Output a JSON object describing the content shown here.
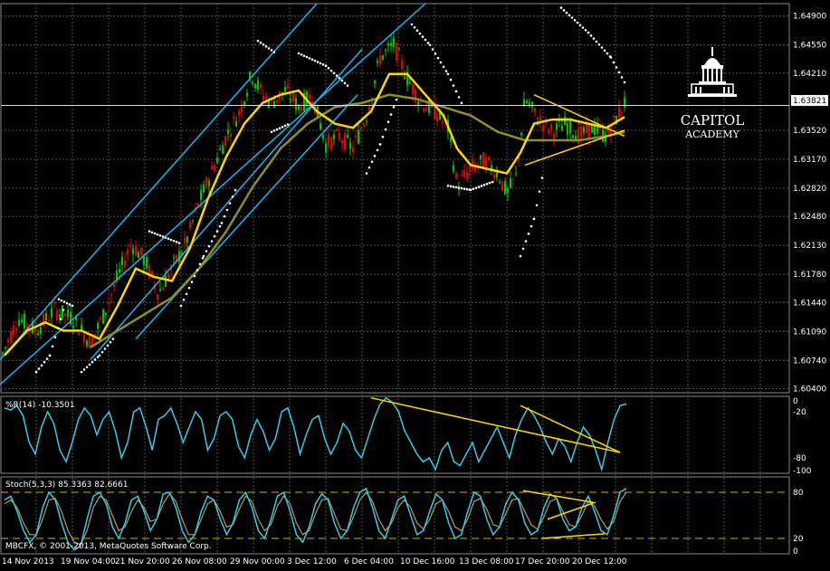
{
  "colors": {
    "background": "#000000",
    "grid": "#4a5a4a",
    "bull": "#00c800",
    "bear": "#e60000",
    "ma_fast": "#ffd700",
    "ma_slow": "#8f8f2a",
    "channel": "#1eb4f0",
    "sar": "#ffffff",
    "wpr": "#3cc8e6",
    "stoch_main": "#3cc8e6",
    "stoch_signal": "#b4a050",
    "trendline": "#ffd700",
    "level": "#c8b400"
  },
  "logo": {
    "line1": "CAPITOL",
    "line2": "ACADEMY",
    "icon": "capitol-dome-icon"
  },
  "current_price": "1.63821",
  "wpr_label": "%R(14) -10.3501",
  "stoch_label": "Stoch(5,3,3) 85.3363 82.6661",
  "copyright": "MBCFX, © 2001-2013, MetaQuotes Software Corp.",
  "chart_data": [
    {
      "type": "candlestick",
      "title": "",
      "ylim": [
        1.6035,
        1.6505
      ],
      "y_ticks": [
        "1.64900",
        "1.64550",
        "1.64210",
        "1.63520",
        "1.63170",
        "1.62820",
        "1.62480",
        "1.62130",
        "1.61780",
        "1.61440",
        "1.61090",
        "1.60740",
        "1.60400"
      ],
      "x_ticks": [
        "14 Nov 2013",
        "19 Nov 04:00",
        "21 Nov 20:00",
        "26 Nov 08:00",
        "29 Nov 00:00",
        "3 Dec 12:00",
        "6 Dec 04:00",
        "10 Dec 16:00",
        "13 Dec 08:00",
        "17 Dec 20:00",
        "20 Dec 12:00"
      ],
      "price_path": [
        [
          0,
          1.6075
        ],
        [
          20,
          1.6125
        ],
        [
          40,
          1.611
        ],
        [
          60,
          1.6135
        ],
        [
          80,
          1.6125
        ],
        [
          100,
          1.6095
        ],
        [
          115,
          1.613
        ],
        [
          130,
          1.6175
        ],
        [
          145,
          1.6215
        ],
        [
          160,
          1.6195
        ],
        [
          175,
          1.6155
        ],
        [
          190,
          1.6185
        ],
        [
          205,
          1.6215
        ],
        [
          220,
          1.6265
        ],
        [
          235,
          1.6305
        ],
        [
          250,
          1.6345
        ],
        [
          265,
          1.6375
        ],
        [
          278,
          1.642
        ],
        [
          290,
          1.6395
        ],
        [
          300,
          1.6385
        ],
        [
          315,
          1.64
        ],
        [
          330,
          1.638
        ],
        [
          345,
          1.6395
        ],
        [
          360,
          1.6335
        ],
        [
          375,
          1.6345
        ],
        [
          390,
          1.633
        ],
        [
          405,
          1.637
        ],
        [
          420,
          1.644
        ],
        [
          435,
          1.6455
        ],
        [
          450,
          1.6415
        ],
        [
          465,
          1.6385
        ],
        [
          480,
          1.6375
        ],
        [
          495,
          1.6355
        ],
        [
          505,
          1.6285
        ],
        [
          520,
          1.6305
        ],
        [
          535,
          1.6315
        ],
        [
          550,
          1.63
        ],
        [
          560,
          1.6275
        ],
        [
          570,
          1.6295
        ],
        [
          580,
          1.639
        ],
        [
          595,
          1.6365
        ],
        [
          610,
          1.635
        ],
        [
          625,
          1.636
        ],
        [
          640,
          1.6345
        ],
        [
          655,
          1.6355
        ],
        [
          670,
          1.6345
        ],
        [
          680,
          1.6365
        ],
        [
          690,
          1.6385
        ]
      ],
      "ma_fast": [
        [
          5,
          1.608
        ],
        [
          30,
          1.611
        ],
        [
          50,
          1.612
        ],
        [
          70,
          1.611
        ],
        [
          90,
          1.611
        ],
        [
          110,
          1.61
        ],
        [
          130,
          1.614
        ],
        [
          150,
          1.6185
        ],
        [
          170,
          1.6175
        ],
        [
          190,
          1.617
        ],
        [
          210,
          1.621
        ],
        [
          230,
          1.627
        ],
        [
          250,
          1.632
        ],
        [
          270,
          1.636
        ],
        [
          290,
          1.6385
        ],
        [
          310,
          1.6395
        ],
        [
          330,
          1.64
        ],
        [
          350,
          1.6375
        ],
        [
          370,
          1.636
        ],
        [
          390,
          1.6355
        ],
        [
          410,
          1.6375
        ],
        [
          430,
          1.642
        ],
        [
          450,
          1.642
        ],
        [
          470,
          1.6395
        ],
        [
          490,
          1.637
        ],
        [
          505,
          1.633
        ],
        [
          520,
          1.631
        ],
        [
          540,
          1.6305
        ],
        [
          560,
          1.63
        ],
        [
          575,
          1.6325
        ],
        [
          590,
          1.636
        ],
        [
          610,
          1.6365
        ],
        [
          630,
          1.6365
        ],
        [
          650,
          1.636
        ],
        [
          670,
          1.6355
        ],
        [
          690,
          1.6368
        ]
      ],
      "ma_slow": [
        [
          100,
          1.609
        ],
        [
          130,
          1.611
        ],
        [
          160,
          1.613
        ],
        [
          190,
          1.615
        ],
        [
          220,
          1.6185
        ],
        [
          250,
          1.623
        ],
        [
          280,
          1.6285
        ],
        [
          310,
          1.633
        ],
        [
          340,
          1.636
        ],
        [
          370,
          1.638
        ],
        [
          400,
          1.6385
        ],
        [
          430,
          1.6395
        ],
        [
          460,
          1.639
        ],
        [
          490,
          1.638
        ],
        [
          520,
          1.637
        ],
        [
          550,
          1.635
        ],
        [
          580,
          1.634
        ],
        [
          610,
          1.634
        ],
        [
          640,
          1.634
        ],
        [
          670,
          1.6345
        ],
        [
          690,
          1.635
        ]
      ],
      "sar_segments": [
        [
          [
            40,
            1.606
          ],
          [
            55,
            1.608
          ],
          [
            70,
            1.6135
          ]
        ],
        [
          [
            90,
            1.606
          ],
          [
            110,
            1.608
          ],
          [
            125,
            1.61
          ]
        ],
        [
          [
            65,
            1.6148
          ],
          [
            80,
            1.614
          ]
        ],
        [
          [
            165,
            1.623
          ],
          [
            200,
            1.6215
          ]
        ],
        [
          [
            200,
            1.614
          ],
          [
            225,
            1.62
          ],
          [
            245,
            1.624
          ],
          [
            262,
            1.6285
          ]
        ],
        [
          [
            285,
            1.646
          ],
          [
            305,
            1.6445
          ]
        ],
        [
          [
            330,
            1.6445
          ],
          [
            360,
            1.643
          ],
          [
            385,
            1.6405
          ]
        ],
        [
          [
            300,
            1.635
          ],
          [
            320,
            1.636
          ]
        ],
        [
          [
            405,
            1.63
          ],
          [
            420,
            1.6335
          ],
          [
            440,
            1.6395
          ]
        ],
        [
          [
            455,
            1.648
          ],
          [
            475,
            1.6455
          ],
          [
            495,
            1.642
          ],
          [
            510,
            1.6385
          ]
        ],
        [
          [
            495,
            1.6285
          ],
          [
            520,
            1.628
          ],
          [
            545,
            1.629
          ]
        ],
        [
          [
            575,
            1.62
          ],
          [
            590,
            1.6245
          ],
          [
            600,
            1.63
          ]
        ],
        [
          [
            620,
            1.65
          ],
          [
            650,
            1.647
          ],
          [
            675,
            1.644
          ],
          [
            690,
            1.641
          ]
        ]
      ],
      "channel": [
        [
          [
            0,
            1.6075
          ],
          [
            350,
            1.6505
          ]
        ],
        [
          [
            0,
            1.6045
          ],
          [
            470,
            1.6505
          ]
        ],
        [
          [
            100,
            1.6075
          ],
          [
            400,
            1.645
          ]
        ],
        [
          [
            150,
            1.61
          ],
          [
            395,
            1.6395
          ]
        ]
      ],
      "triangle": [
        [
          [
            590,
            1.6395
          ],
          [
            690,
            1.6345
          ]
        ],
        [
          [
            580,
            1.631
          ],
          [
            690,
            1.6352
          ]
        ]
      ]
    },
    {
      "type": "line",
      "name": "%R(14)",
      "ylim": [
        -100,
        0
      ],
      "y_ticks": [
        "0",
        "-20",
        "-80",
        "-100"
      ],
      "values": [
        -15,
        -18,
        -12,
        -25,
        -60,
        -75,
        -40,
        -20,
        -35,
        -70,
        -85,
        -60,
        -30,
        -15,
        -25,
        -50,
        -30,
        -20,
        -45,
        -80,
        -60,
        -20,
        -15,
        -40,
        -70,
        -30,
        -25,
        -15,
        -35,
        -60,
        -40,
        -20,
        -30,
        -70,
        -55,
        -25,
        -20,
        -30,
        -65,
        -80,
        -50,
        -30,
        -45,
        -70,
        -55,
        -20,
        -15,
        -40,
        -75,
        -50,
        -30,
        -25,
        -55,
        -75,
        -60,
        -35,
        -45,
        -70,
        -80,
        -55,
        -30,
        -10,
        -2,
        -8,
        -20,
        -45,
        -60,
        -75,
        -85,
        -80,
        -95,
        -70,
        -60,
        -85,
        -90,
        -75,
        -60,
        -85,
        -70,
        -55,
        -40,
        -60,
        -80,
        -50,
        -30,
        -15,
        -25,
        -40,
        -60,
        -75,
        -55,
        -65,
        -85,
        -60,
        -40,
        -50,
        -70,
        -95,
        -60,
        -30,
        -12,
        -10
      ],
      "trendlines": [
        [
          [
            410,
            -2
          ],
          [
            685,
            -73
          ]
        ],
        [
          [
            575,
            -12
          ],
          [
            685,
            -73
          ]
        ]
      ]
    },
    {
      "type": "line",
      "name": "Stoch(5,3,3)",
      "ylim": [
        0,
        100
      ],
      "levels": [
        80,
        20
      ],
      "y_ticks": [
        "80",
        "20",
        "0"
      ],
      "main": [
        70,
        75,
        55,
        30,
        15,
        25,
        60,
        80,
        70,
        40,
        15,
        5,
        10,
        45,
        75,
        80,
        65,
        35,
        20,
        40,
        70,
        75,
        55,
        30,
        45,
        78,
        80,
        60,
        30,
        15,
        25,
        55,
        75,
        70,
        45,
        25,
        40,
        70,
        80,
        60,
        30,
        20,
        45,
        75,
        80,
        55,
        25,
        15,
        35,
        65,
        78,
        70,
        40,
        20,
        30,
        60,
        80,
        85,
        60,
        30,
        20,
        45,
        70,
        75,
        50,
        25,
        30,
        55,
        78,
        70,
        40,
        20,
        25,
        55,
        80,
        75,
        45,
        25,
        35,
        65,
        80,
        70,
        40,
        25,
        30,
        60,
        78,
        72,
        45,
        30,
        35,
        60,
        75,
        55,
        30,
        25,
        50,
        80,
        85
      ],
      "signal": [
        65,
        70,
        60,
        40,
        25,
        25,
        45,
        70,
        72,
        55,
        30,
        15,
        12,
        30,
        60,
        75,
        70,
        50,
        30,
        35,
        55,
        70,
        60,
        42,
        45,
        65,
        78,
        68,
        45,
        25,
        25,
        45,
        65,
        70,
        55,
        35,
        38,
        58,
        75,
        68,
        45,
        30,
        38,
        62,
        75,
        65,
        40,
        25,
        30,
        52,
        70,
        72,
        52,
        32,
        30,
        48,
        70,
        80,
        68,
        45,
        30,
        40,
        60,
        70,
        60,
        40,
        32,
        45,
        65,
        70,
        55,
        35,
        30,
        45,
        68,
        72,
        58,
        38,
        35,
        52,
        70,
        72,
        55,
        38,
        32,
        48,
        68,
        72,
        55,
        38,
        35,
        50,
        68,
        62,
        45,
        32,
        42,
        68,
        80
      ],
      "trendlines": [
        [
          [
            578,
            82
          ],
          [
            655,
            67
          ]
        ],
        [
          [
            598,
            20
          ],
          [
            668,
            26
          ]
        ],
        [
          [
            605,
            45
          ],
          [
            658,
            67
          ]
        ]
      ]
    }
  ]
}
